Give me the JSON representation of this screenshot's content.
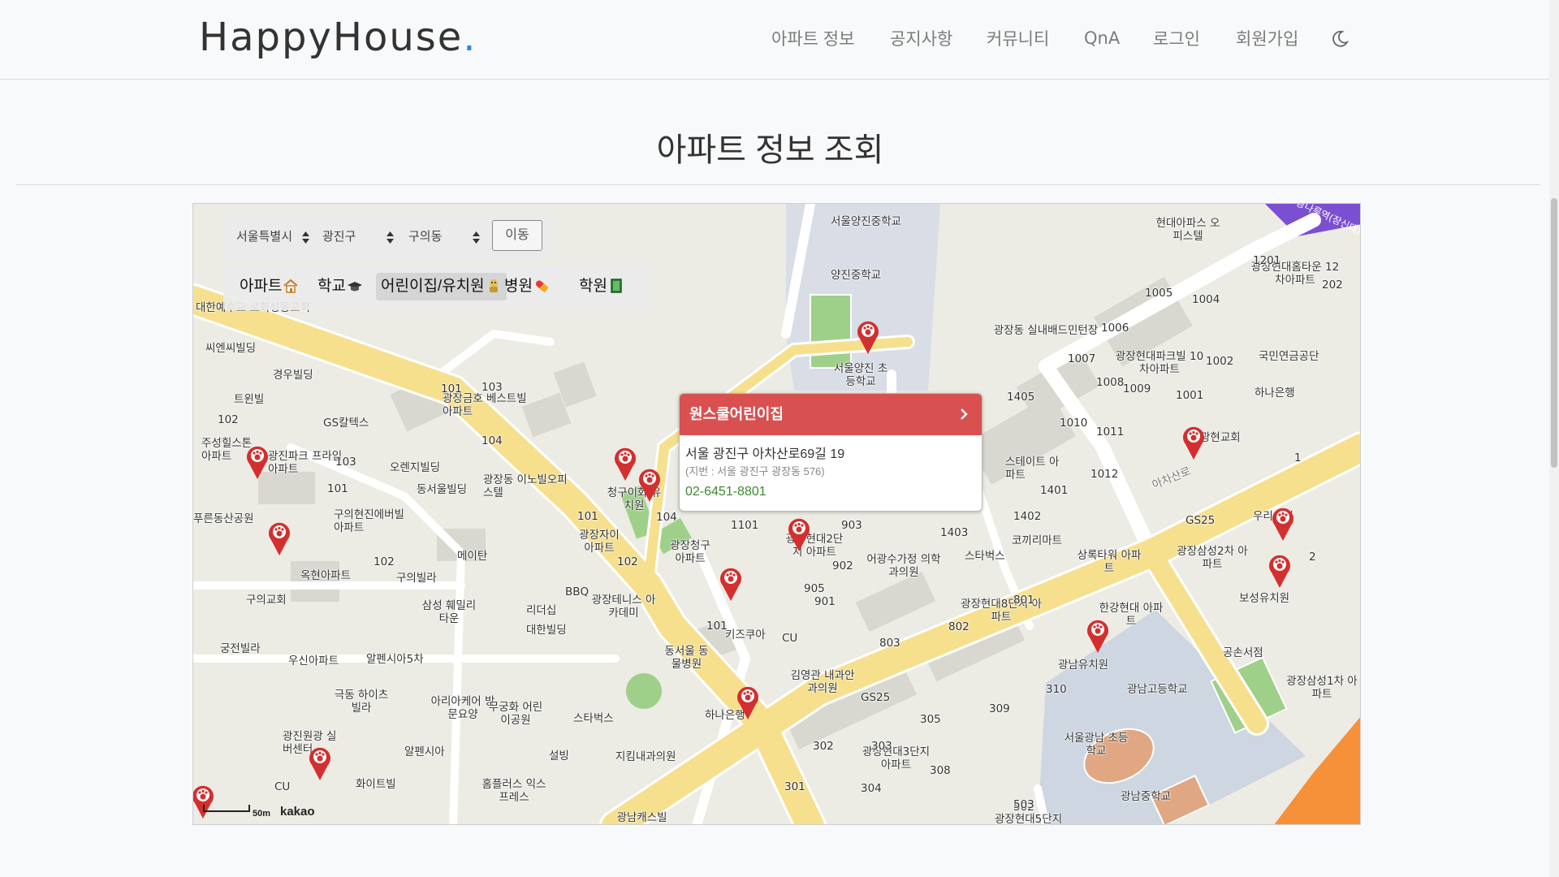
{
  "brand": {
    "name": "HappyHouse",
    "dot": "."
  },
  "nav": {
    "items": [
      "아파트 정보",
      "공지사항",
      "커뮤니티",
      "QnA",
      "로그인",
      "회원가입"
    ],
    "theme_icon": "moon-icon"
  },
  "page": {
    "title": "아파트 정보 조회"
  },
  "filters": {
    "city": "서울특별시",
    "district": "광진구",
    "dong": "구의동",
    "go_label": "이동"
  },
  "categories": [
    {
      "label": "아파트",
      "icon": "house-icon"
    },
    {
      "label": "학교",
      "icon": "graduation-cap-icon"
    },
    {
      "label": "어린이집/유치원",
      "icon": "toy-icon"
    },
    {
      "label": "병원",
      "icon": "pill-icon"
    },
    {
      "label": "학원",
      "icon": "book-icon"
    }
  ],
  "active_category": "어린이집/유치원",
  "popup": {
    "name": "원스쿨어린이집",
    "address": "서울 광진구 아차산로69길 19",
    "jibun": "(지번 : 서울 광진구 광장동 576)",
    "phone": "02-6451-8801"
  },
  "map": {
    "scale": "50m",
    "provider": "kakao",
    "labels": [
      "대한예수교 로회성동교회",
      "씨엔씨빌딩",
      "경우빌딩",
      "트윈빌",
      "102",
      "GS칼텍스",
      "주성힐스톤 아파트",
      "광진파크 프라임아파트",
      "103",
      "101",
      "광장금호 베스트빌아파트",
      "101",
      "103",
      "104",
      "오렌지빌딩",
      "동서울빌딩",
      "광장동 이노빌오피스텔",
      "푸른동산공원",
      "구의현진에버빌 아파트",
      "102",
      "구의빌라",
      "메이탄",
      "옥현아파트",
      "구의교회",
      "삼성 훼밀리타운",
      "리더십",
      "대한빌딩",
      "궁전빌라",
      "우신아파트",
      "알펜시아5차",
      "극동 하이츠빌라",
      "아리아케어 방문요양",
      "무궁화 어린이공원",
      "알펜시아",
      "광진원광 실버센터",
      "화이트빌",
      "홈플러스 익스프레스",
      "CU",
      "101",
      "청구이화 유치원",
      "광장자이 아파트",
      "104",
      "102",
      "광장청구 아파트",
      "광장테니스 아카데미",
      "동서울 동물병원",
      "키즈쿠아",
      "CU",
      "101",
      "하나은행",
      "김영관 내과안과의원",
      "GS25",
      "지킴내과의원",
      "스타벅스",
      "설빙",
      "광남캐스빌 아파트",
      "BBQ",
      "광장현대3단지 아파트",
      "302",
      "301",
      "304",
      "303",
      "308",
      "305",
      "309",
      "310",
      "502",
      "503",
      "광장현대5단지",
      "광장현대8단지 아파트",
      "802",
      "803",
      "801",
      "어광수가정 의학과의원",
      "스타벅스",
      "901",
      "902",
      "903",
      "905",
      "1101",
      "1403",
      "광장현대2단지 아파트",
      "코끼리마트",
      "스테이트 아파트",
      "1402",
      "1401",
      "1405",
      "서울양진 초등학교",
      "양진중학교",
      "광장동 실내배드민턴장",
      "1005",
      "1004",
      "1006",
      "1007",
      "1008",
      "1009",
      "1010",
      "1011",
      "1012",
      "1001",
      "1002",
      "광장현대파크빌 10차아파트",
      "현대아파스 오피스텔",
      "광장현대홈타운 12차아파트",
      "1201",
      "202",
      "국민연금공단",
      "하나은행",
      "광현교회",
      "GS25",
      "우리은행",
      "1",
      "2",
      "광장삼성2차 아파트",
      "보성유치원",
      "상록타워 아파트",
      "한강현대 아파트",
      "광남유치원",
      "광남고등학교",
      "공손서점",
      "서울광남 초등학교",
      "광남중학교",
      "광장삼성1차 아파트",
      "광나루역(장신대)",
      "아차산로",
      "서울양진중학교"
    ]
  }
}
